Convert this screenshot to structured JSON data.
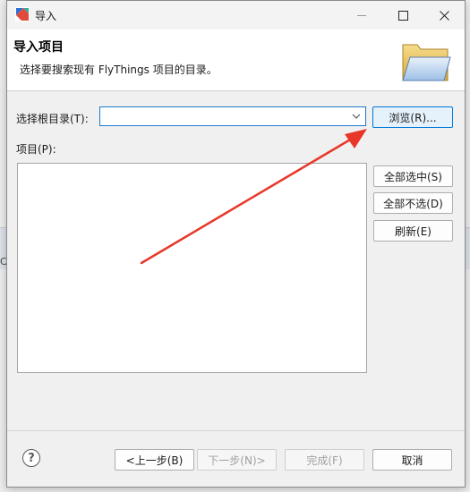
{
  "window": {
    "title": "导入",
    "app_icon": "app-logo-icon"
  },
  "header": {
    "title": "导入项目",
    "description": "选择要搜索现有 FlyThings 项目的目录。",
    "graphic": "folder-icon"
  },
  "root_dir": {
    "label": "选择根目录(T):",
    "value": "",
    "browse_label": "浏览(R)..."
  },
  "projects": {
    "label": "项目(P):",
    "items": [],
    "select_all_label": "全部选中(S)",
    "deselect_all_label": "全部不选(D)",
    "refresh_label": "刷新(E)"
  },
  "footer": {
    "help_icon": "help-icon",
    "back_label": "<上一步(B)",
    "next_label": "下一步(N)>",
    "finish_label": "完成(F)",
    "cancel_label": "取消"
  },
  "background": {
    "partial_text": "Co"
  },
  "colors": {
    "accent": "#0078d7",
    "annotation_arrow": "#e8372a"
  }
}
